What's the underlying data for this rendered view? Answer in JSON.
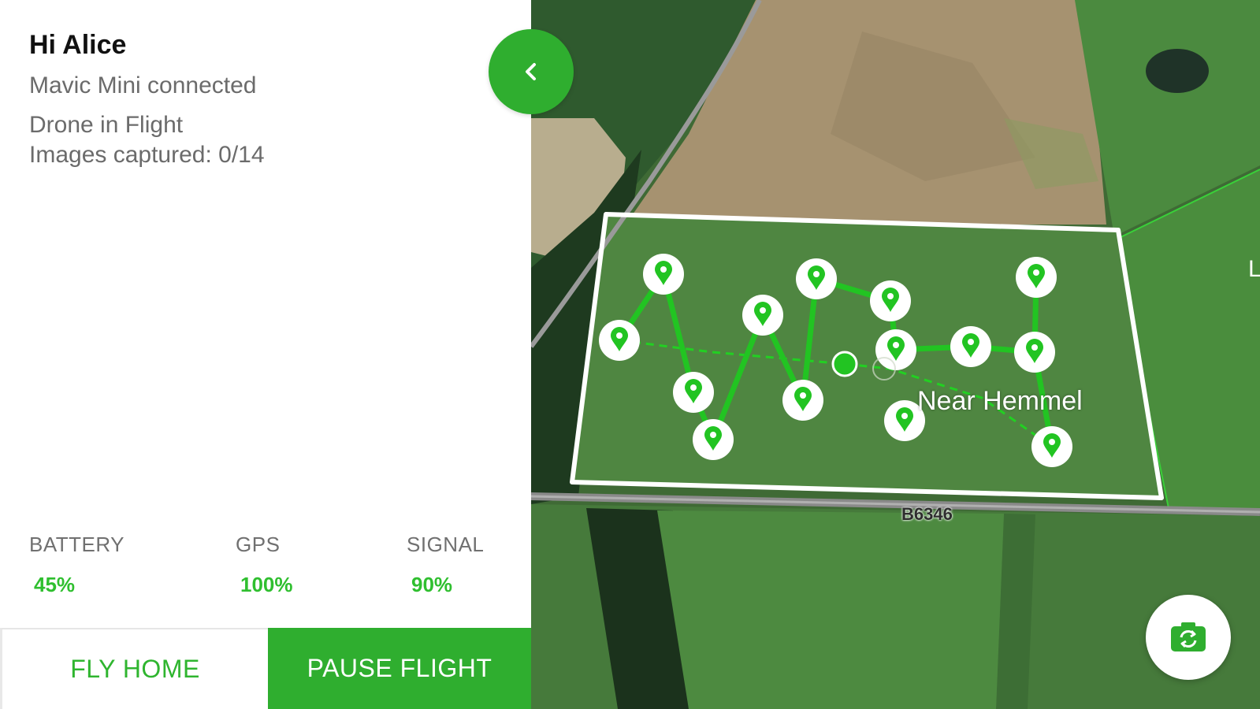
{
  "greeting": "Hi Alice",
  "status": {
    "connection": "Mavic Mini connected",
    "flight_state": "Drone in Flight",
    "images": "Images captured: 0/14"
  },
  "stats": {
    "battery": {
      "label": "BATTERY",
      "value": "45%"
    },
    "gps": {
      "label": "GPS",
      "value": "100%"
    },
    "signal": {
      "label": "SIGNAL",
      "value": "90%"
    }
  },
  "buttons": {
    "fly_home": "FLY HOME",
    "pause_flight": "PAUSE FLIGHT"
  },
  "map": {
    "place_label": "Near Hemmel",
    "road_label": "B6346",
    "edge_letter": "L",
    "waypoint_count": 14
  },
  "icons": {
    "collapse": "chevron-left-icon",
    "camera": "camera-switch-icon",
    "waypoint": "map-pin-icon",
    "drone": "drone-position-icon"
  },
  "colors": {
    "accent": "#2fae2f",
    "value_green": "#2fbf2f",
    "route": "#22c422"
  }
}
